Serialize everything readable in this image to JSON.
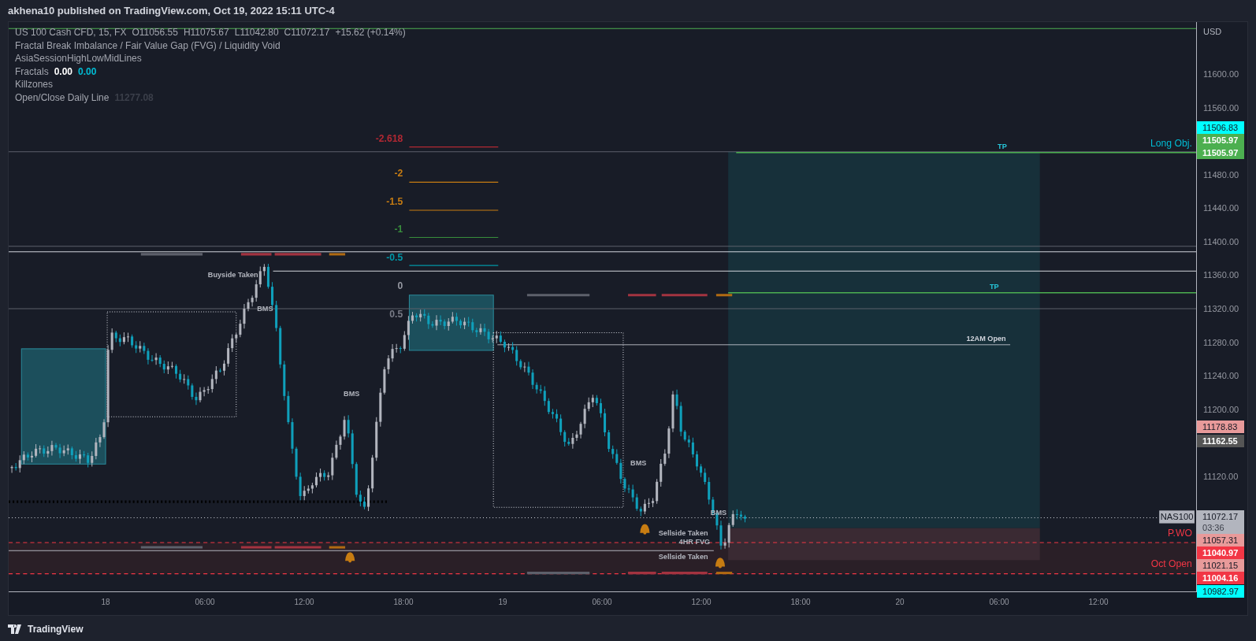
{
  "header": {
    "title": "akhena10 published on TradingView.com, Oct 19, 2022 15:11 UTC-4"
  },
  "legend": {
    "symbol": "US 100 Cash CFD, 15, FX",
    "ohlc": [
      "O11056.55",
      "H11075.67",
      "L11042.80",
      "C11072.17",
      "+15.62 (+0.14%)"
    ],
    "indicators": [
      {
        "name": "Fractal Break Imbalance / Fair Value Gap (FVG) / Liquidity Void"
      },
      {
        "name": "AsiaSessionHighLowMidLines"
      },
      {
        "name": "Fractals",
        "values": [
          {
            "text": "0.00",
            "color": "#ffffff"
          },
          {
            "text": "0.00",
            "color": "#00bcd4"
          }
        ]
      },
      {
        "name": "Killzones"
      },
      {
        "name": "Open/Close Daily Line",
        "values": [
          {
            "text": "11277.08",
            "color": "#3b3f4a"
          }
        ]
      }
    ]
  },
  "chart": {
    "fib_levels": [
      {
        "label": "-2.618",
        "color": "#b22833"
      },
      {
        "label": "-2",
        "color": "#c77c12"
      },
      {
        "label": "-1.5",
        "color": "#c77c12"
      },
      {
        "label": "-1",
        "color": "#388e3c"
      },
      {
        "label": "-0.5",
        "color": "#0097a7"
      },
      {
        "label": "0",
        "color": "#9598a1"
      },
      {
        "label": "0.5",
        "color": "#787b86"
      }
    ],
    "markers": [
      {
        "text": "Buyside Taken",
        "kind": "note"
      },
      {
        "text": "BMS",
        "kind": "note"
      },
      {
        "text": "BMS",
        "kind": "note"
      },
      {
        "text": "BMS",
        "kind": "note"
      },
      {
        "text": "BMS",
        "kind": "note"
      },
      {
        "text": "12AM Open",
        "kind": "level"
      },
      {
        "text": "TP",
        "kind": "target"
      },
      {
        "text": "TP",
        "kind": "target"
      },
      {
        "text": "Sellside Taken",
        "kind": "note"
      },
      {
        "text": "4HR FVG",
        "kind": "note"
      },
      {
        "text": "Sellside Taken",
        "kind": "note"
      }
    ],
    "level_labels": [
      {
        "text": "Long Obj.",
        "color": "#00bcd4"
      },
      {
        "text": "P.WO",
        "color": "#f23645"
      },
      {
        "text": "Oct Open",
        "color": "#f23645"
      }
    ],
    "symbol_tag": "NAS100"
  },
  "price_axis": {
    "currency": "USD",
    "ticks": [
      "11600.00",
      "11560.00",
      "11480.00",
      "11440.00",
      "11400.00",
      "11360.00",
      "11320.00",
      "11280.00",
      "11240.00",
      "11200.00",
      "11120.00"
    ],
    "labels": [
      {
        "text": "11506.83",
        "color": "#00ffff"
      },
      {
        "text": "11505.97",
        "color": "#4caf50"
      },
      {
        "text": "11505.97",
        "color": "#4caf50"
      },
      {
        "text": "11178.83",
        "color": "#e89a9a"
      },
      {
        "text": "11162.55",
        "color": "#555555"
      },
      {
        "text": "11072.17",
        "sub": "03:36",
        "color": "#b2b5be"
      },
      {
        "text": "11057.31",
        "color": "#e89a9a"
      },
      {
        "text": "11040.97",
        "color": "#f23645"
      },
      {
        "text": "11021.15",
        "color": "#e89a9a"
      },
      {
        "text": "11004.16",
        "color": "#f23645"
      },
      {
        "text": "10982.97",
        "color": "#00ffff"
      }
    ]
  },
  "time_axis": {
    "labels": [
      "18",
      "06:00",
      "12:00",
      "18:00",
      "19",
      "06:00",
      "12:00",
      "18:00",
      "20",
      "06:00",
      "12:00"
    ]
  },
  "footer": {
    "brand": "TradingView"
  }
}
